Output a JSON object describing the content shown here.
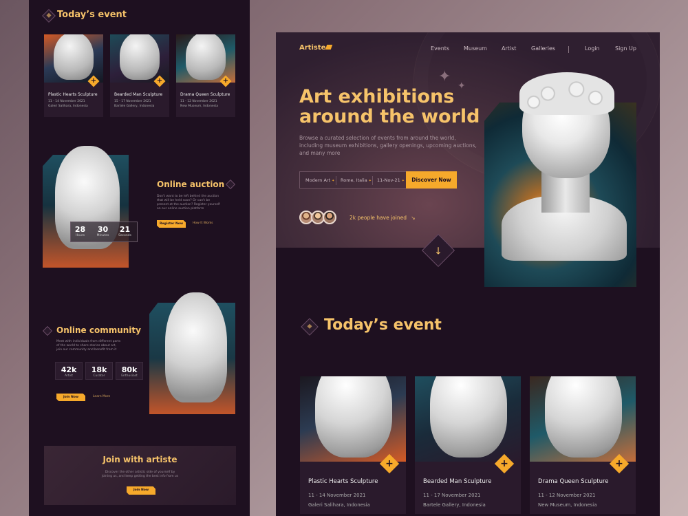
{
  "left": {
    "todays_event": {
      "title": "Today’s event",
      "cards": [
        {
          "title": "Plastic Hearts Sculpture",
          "date": "11 - 14 November 2021",
          "location": "Galeri Salihara, Indonesia"
        },
        {
          "title": "Bearded Man Sculpture",
          "date": "15 - 17 November 2021",
          "location": "Bartele Gallery, Indonesia"
        },
        {
          "title": "Drama Queen Sculpture",
          "date": "11 - 12 November 2021",
          "location": "New Museum, Indonesia"
        }
      ]
    },
    "auction": {
      "title": "Online auction",
      "text": "Don't want to be left behind the auction that will be held soon? Or can't be present at the auction? Register yourself on our online auction platform",
      "register": "Register Now",
      "how": "How It Works",
      "countdown": [
        {
          "value": "28",
          "label": "Hours"
        },
        {
          "value": "30",
          "label": "Minutes"
        },
        {
          "value": "21",
          "label": "Seconds"
        }
      ]
    },
    "community": {
      "title": "Online community",
      "text": "Meet with individuals from different parts of the world to share stories about art, join our community and benefit from it",
      "stats": [
        {
          "value": "42k",
          "label": "Artist"
        },
        {
          "value": "18k",
          "label": "Curator"
        },
        {
          "value": "80k",
          "label": "Enthusiast"
        }
      ],
      "join": "Join Now",
      "learn": "Learn More"
    },
    "join": {
      "title": "Join with artiste",
      "text": "Discover the other artistic side of yourself by joining us, and keep getting the best info from us",
      "button": "Join Now"
    }
  },
  "right": {
    "logo": "Artiste",
    "nav": [
      "Events",
      "Museum",
      "Artist",
      "Galleries"
    ],
    "login": "Login",
    "signup": "Sign Up",
    "hero_line1": "Art exhibitions",
    "hero_line2": "around the world",
    "subtitle": "Browse a curated selection of events from around the world, including museum exhibitions, gallery openings, upcoming auctions, and many more",
    "search": {
      "category": "Modern Art",
      "place": "Rome, Italia",
      "date": "11-Nov-21",
      "button": "Discover Now"
    },
    "joined": "2k people have joined",
    "section_title": "Today’s event",
    "cards": [
      {
        "title": "Plastic Hearts Sculpture",
        "date": "11 - 14 November 2021",
        "location": "Galeri Salihara, Indonesia"
      },
      {
        "title": "Bearded Man Sculpture",
        "date": "11 - 17 November 2021",
        "location": "Bartele Gallery, Indonesia"
      },
      {
        "title": "Drama Queen Sculpture",
        "date": "11 - 12 November 2021",
        "location": "New Museum, Indonesia"
      }
    ]
  },
  "colors": {
    "accent": "#f6a92b",
    "title_gold": "#f6c36a",
    "panel_bg": "#1e1020"
  }
}
